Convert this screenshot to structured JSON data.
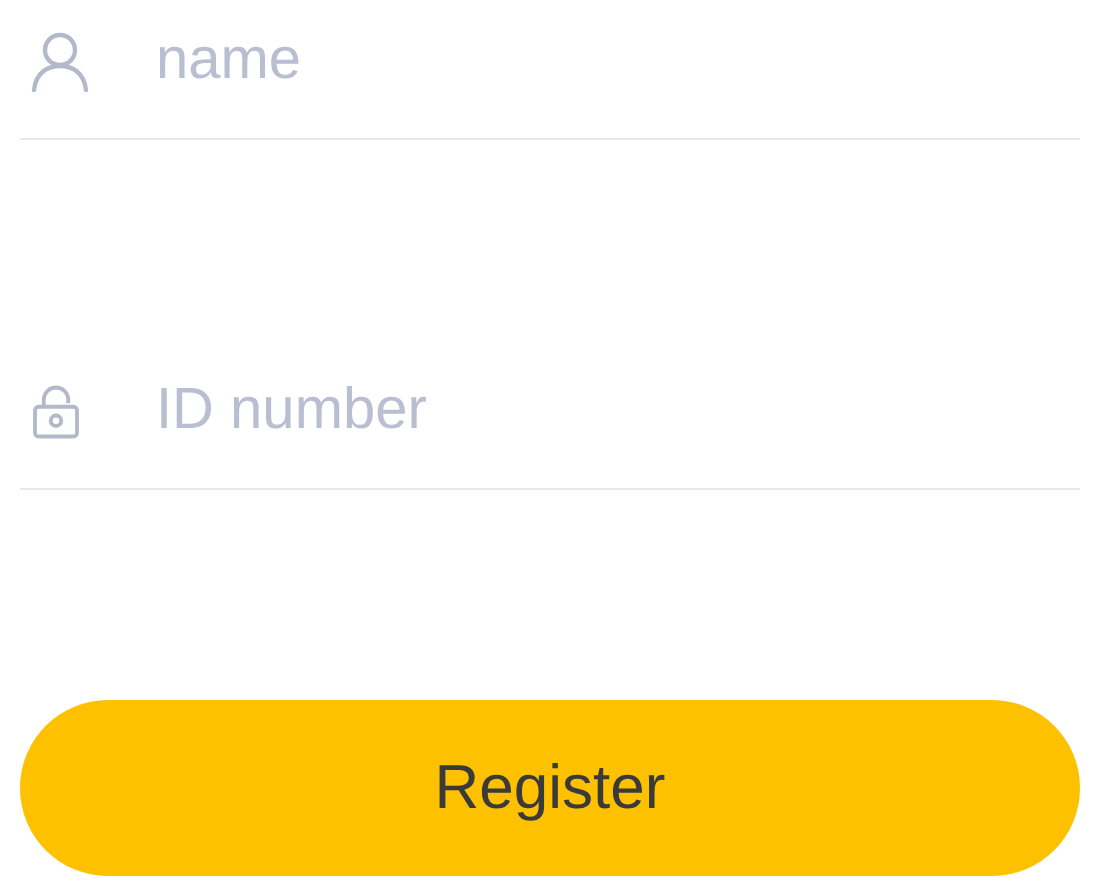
{
  "fields": [
    {
      "kind": "user",
      "placeholder": "name"
    },
    {
      "kind": "lock",
      "placeholder": "ID number"
    }
  ],
  "button": {
    "label": "Register"
  }
}
